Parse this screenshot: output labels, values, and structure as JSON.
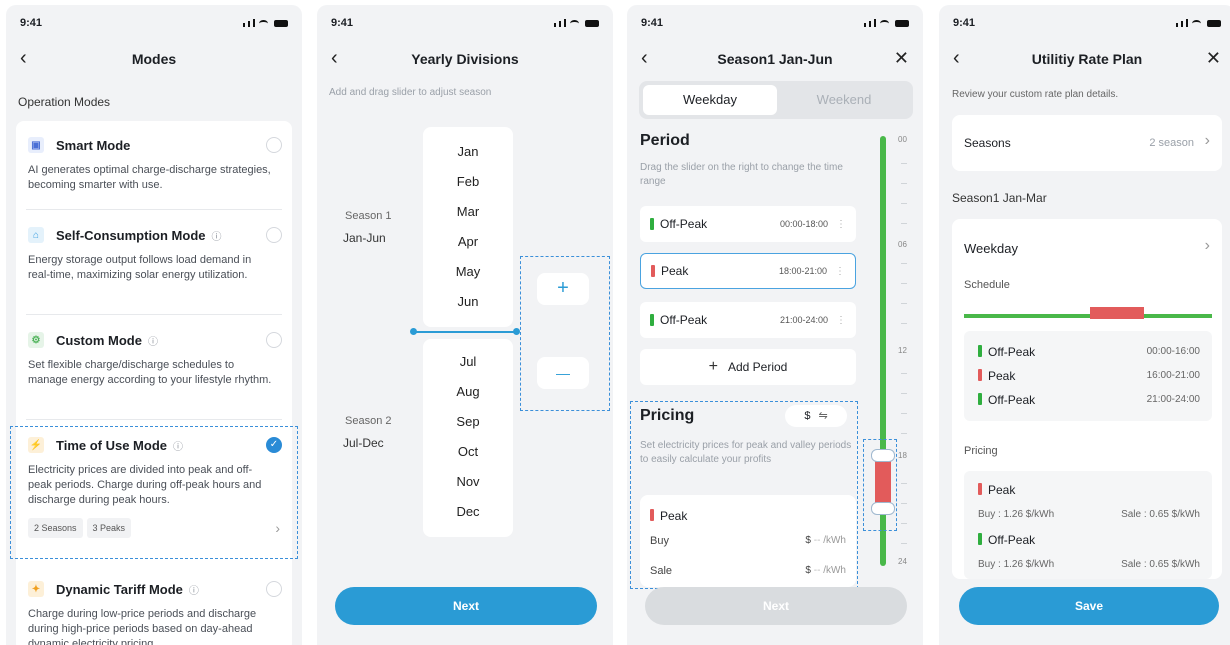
{
  "status": {
    "time": "9:41"
  },
  "screen1": {
    "title": "Modes",
    "section": "Operation Modes",
    "modes": [
      {
        "name": "Smart Mode",
        "desc": "AI generates optimal charge-discharge strategies, becoming smarter with use.",
        "icon": "chip-icon",
        "color": "#4a6fd6"
      },
      {
        "name": "Self-Consumption Mode",
        "desc": "Energy storage output follows load demand in real-time, maximizing solar energy utilization.",
        "icon": "house-icon",
        "color": "#3a9ee0"
      },
      {
        "name": "Custom Mode",
        "desc": "Set flexible charge/discharge schedules to manage energy according to your lifestyle rhythm.",
        "icon": "gear-icon",
        "color": "#4fb35a"
      },
      {
        "name": "Time of Use Mode",
        "desc": "Electricity prices are divided into peak and off-peak periods. Charge during off-peak hours and discharge during peak hours.",
        "icon": "bolt-icon",
        "color": "#f0a020"
      },
      {
        "name": "Dynamic Tariff Mode",
        "desc": "Charge during low-price periods and discharge during high-price periods based on day-ahead dynamic electricity pricing",
        "icon": "star-icon",
        "color": "#f0a020"
      }
    ],
    "tags": [
      "2 Seasons",
      "3 Peaks"
    ]
  },
  "screen2": {
    "title": "Yearly Divisions",
    "hint": "Add and drag slider to adjust season",
    "months_top": [
      "Jan",
      "Feb",
      "Mar",
      "Apr",
      "May",
      "Jun"
    ],
    "months_bottom": [
      "Jul",
      "Aug",
      "Sep",
      "Oct",
      "Nov",
      "Dec"
    ],
    "season1_label": "Season 1",
    "season1_range": "Jan-Jun",
    "season2_label": "Season 2",
    "season2_range": "Jul-Dec",
    "plus": "+",
    "minus": "—",
    "next": "Next"
  },
  "screen3": {
    "title": "Season1 Jan-Jun",
    "tab_weekday": "Weekday",
    "tab_weekend": "Weekend",
    "period_title": "Period",
    "period_hint": "Drag the slider on the right to change the time range",
    "periods": [
      {
        "name": "Off-Peak",
        "time": "00:00-18:00",
        "type": "off"
      },
      {
        "name": "Peak",
        "time": "18:00-21:00",
        "type": "peak"
      },
      {
        "name": "Off-Peak",
        "time": "21:00-24:00",
        "type": "off"
      }
    ],
    "add_period": "Add Period",
    "pricing_title": "Pricing",
    "currency": "$",
    "pricing_hint": "Set electricity prices for peak and valley periods to easily calculate your profits",
    "price_period": "Peak",
    "buy_label": "Buy",
    "sale_label": "Sale",
    "unit": "/kWh",
    "ticks": [
      "00",
      "06",
      "12",
      "18",
      "24"
    ],
    "next": "Next"
  },
  "screen4": {
    "title": "Utilitiy Rate Plan",
    "hint": "Review your custom rate plan details.",
    "seasons_label": "Seasons",
    "seasons_value": "2 season",
    "season_name": "Season1 Jan-Mar",
    "day_type": "Weekday",
    "schedule_label": "Schedule",
    "schedule": [
      {
        "name": "Off-Peak",
        "time": "00:00-16:00",
        "type": "off"
      },
      {
        "name": "Peak",
        "time": "16:00-21:00",
        "type": "peak"
      },
      {
        "name": "Off-Peak",
        "time": "21:00-24:00",
        "type": "off"
      }
    ],
    "pricing_label": "Pricing",
    "prices": [
      {
        "name": "Peak",
        "type": "peak",
        "buy": "Buy : 1.26 $/kWh",
        "sale": "Sale : 0.65 $/kWh"
      },
      {
        "name": "Off-Peak",
        "type": "off",
        "buy": "Buy : 1.26 $/kWh",
        "sale": "Sale : 0.65 $/kWh"
      }
    ],
    "save": "Save"
  },
  "colors": {
    "accent": "#2a9bd5",
    "offpeak": "#2fae3f",
    "peak": "#e25b5b"
  }
}
